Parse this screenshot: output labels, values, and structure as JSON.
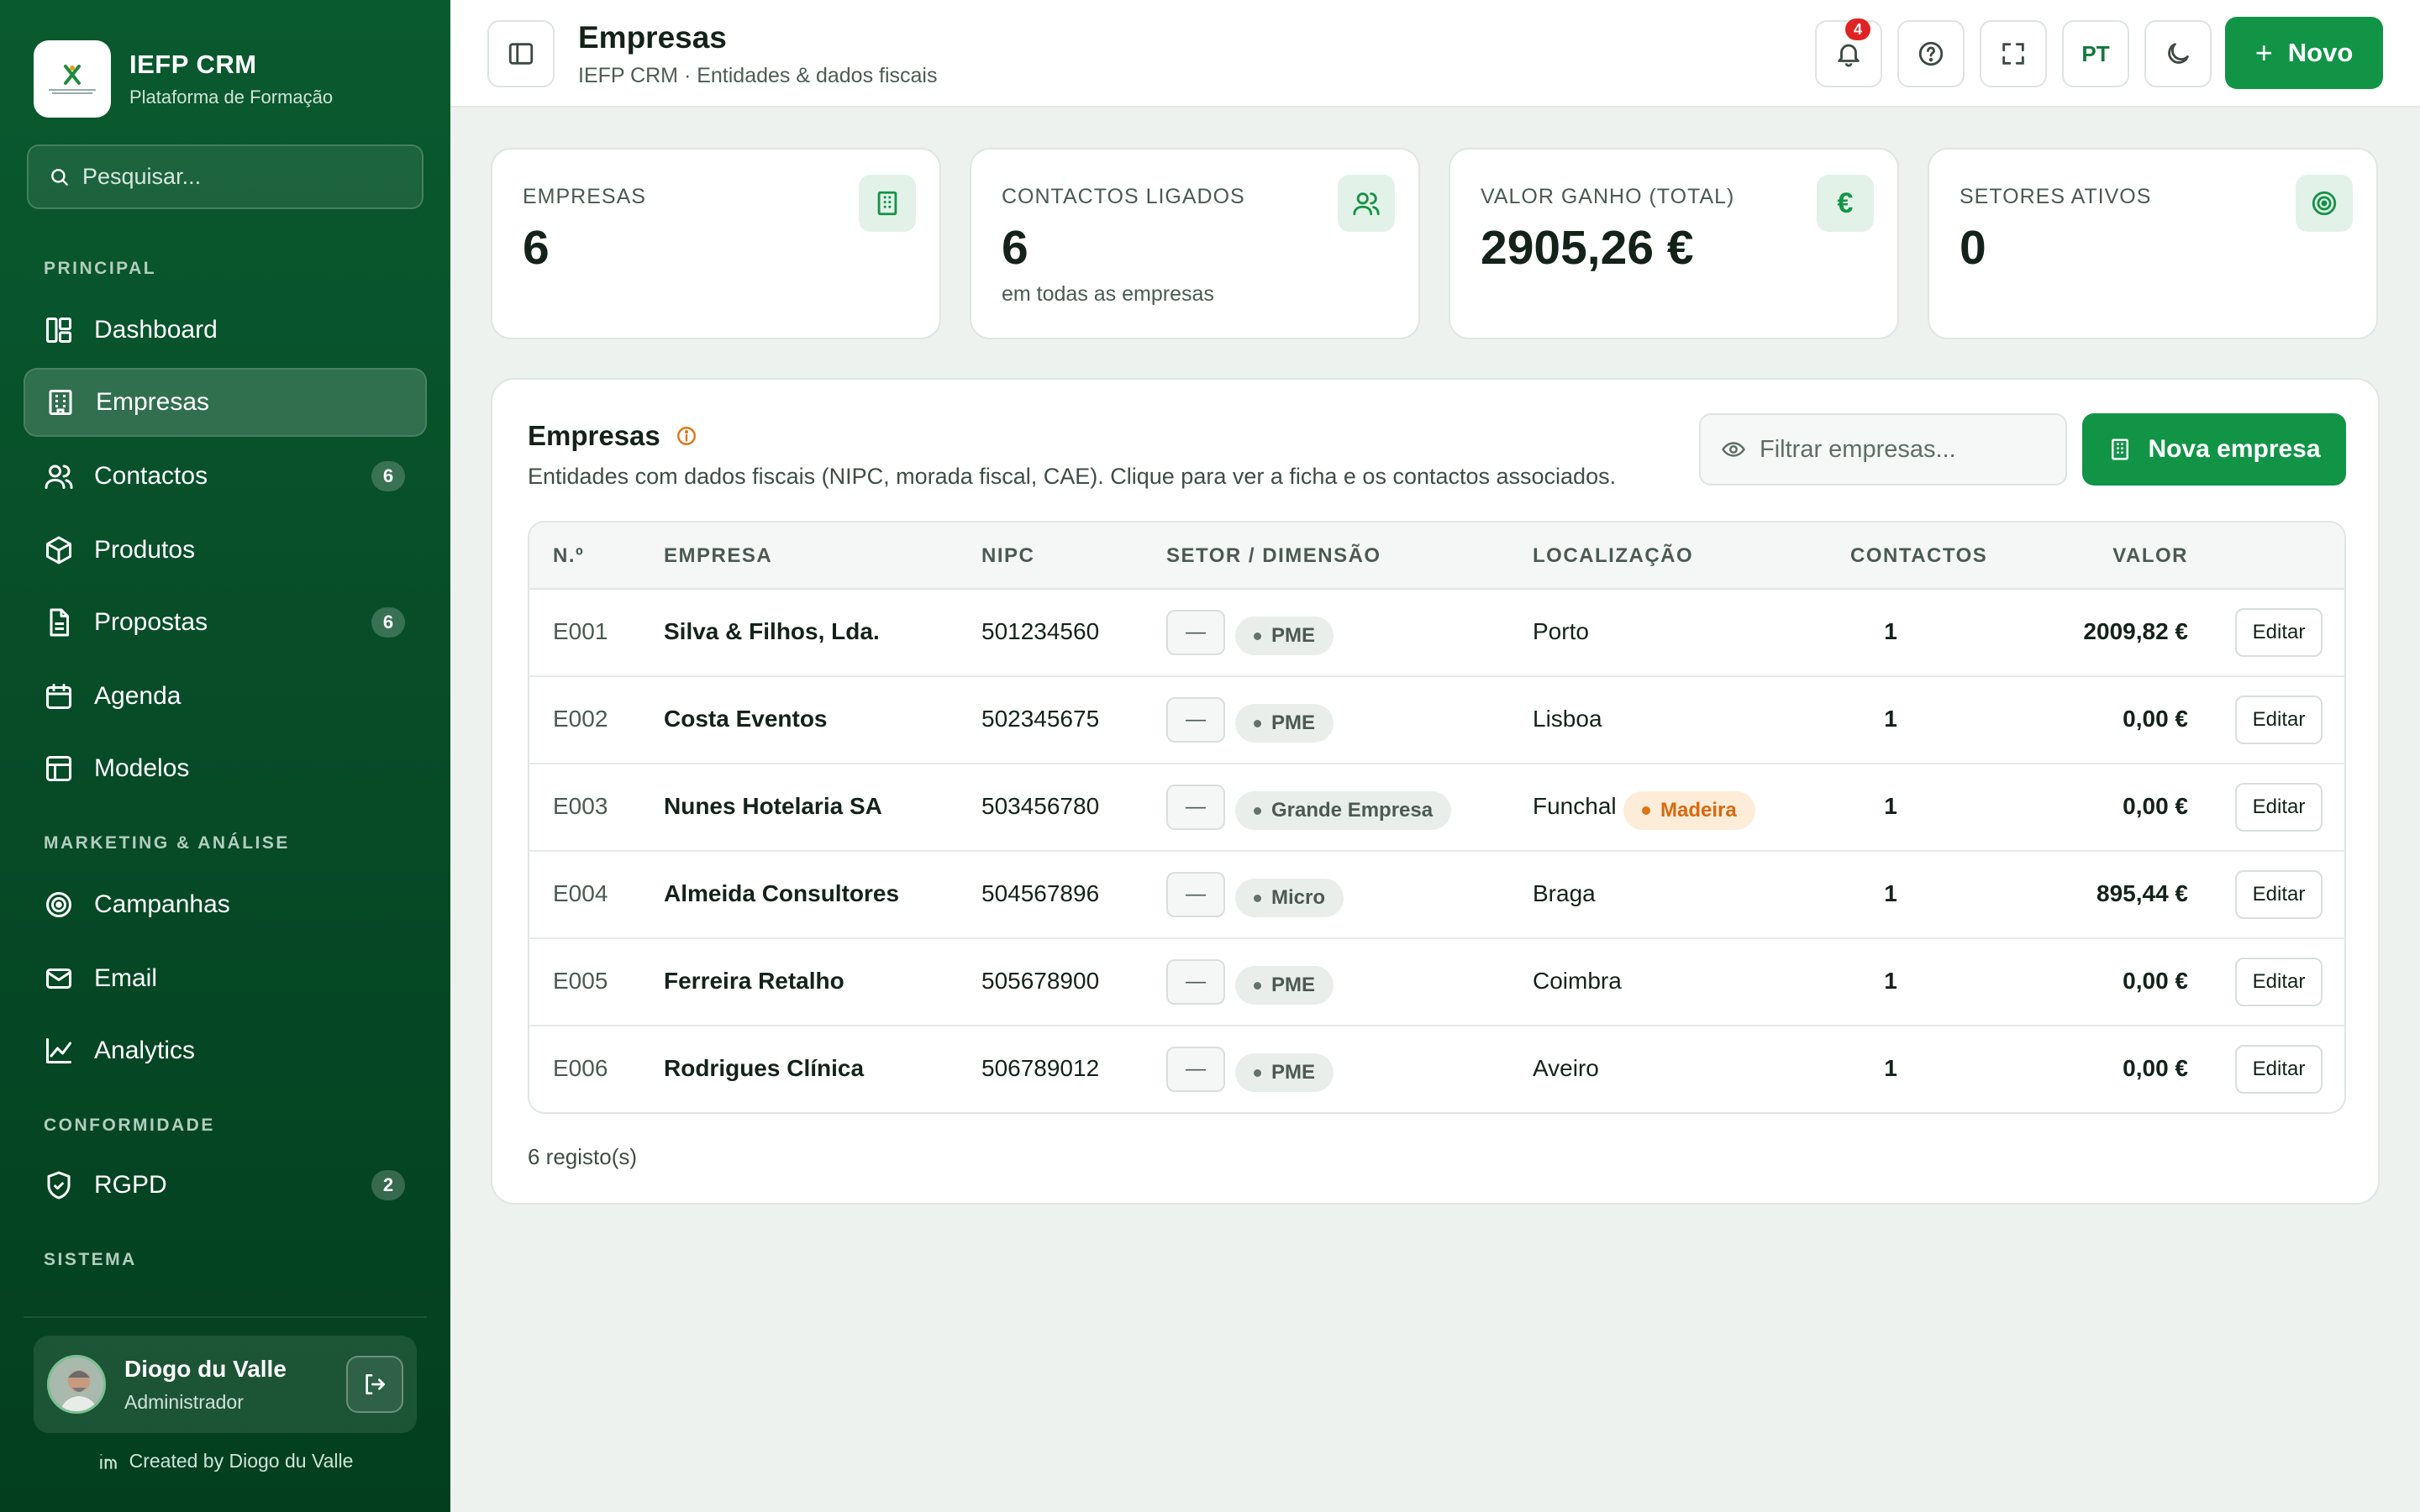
{
  "brand": {
    "name": "IEFP CRM",
    "subtitle": "Plataforma de Formação"
  },
  "search": {
    "placeholder": "Pesquisar..."
  },
  "sidebar": {
    "sections": {
      "principal": "PRINCIPAL",
      "marketing": "MARKETING & ANÁLISE",
      "conformidade": "CONFORMIDADE",
      "sistema": "SISTEMA"
    },
    "items": [
      {
        "label": "Dashboard",
        "icon": "dashboard-icon"
      },
      {
        "label": "Empresas",
        "icon": "building-icon",
        "active": true
      },
      {
        "label": "Contactos",
        "icon": "users-icon",
        "badge": "6"
      },
      {
        "label": "Produtos",
        "icon": "box-icon"
      },
      {
        "label": "Propostas",
        "icon": "file-icon",
        "badge": "6"
      },
      {
        "label": "Agenda",
        "icon": "calendar-icon"
      },
      {
        "label": "Modelos",
        "icon": "layout-icon"
      },
      {
        "label": "Campanhas",
        "icon": "target-icon"
      },
      {
        "label": "Email",
        "icon": "mail-icon"
      },
      {
        "label": "Analytics",
        "icon": "chart-icon"
      },
      {
        "label": "RGPD",
        "icon": "shield-icon",
        "badge": "2"
      }
    ]
  },
  "user": {
    "name": "Diogo du Valle",
    "role": "Administrador"
  },
  "credit": "Created by Diogo du Valle",
  "header": {
    "title": "Empresas",
    "subtitle": "IEFP CRM · Entidades & dados fiscais",
    "notifications": "4",
    "language": "PT",
    "new_label": "Novo"
  },
  "stats": [
    {
      "label": "EMPRESAS",
      "value": "6",
      "note": "",
      "icon": "building-icon"
    },
    {
      "label": "CONTACTOS LIGADOS",
      "value": "6",
      "note": "em todas as empresas",
      "icon": "users-icon"
    },
    {
      "label": "VALOR GANHO (TOTAL)",
      "value": "2905,26 €",
      "note": "",
      "icon": "euro-icon"
    },
    {
      "label": "SETORES ATIVOS",
      "value": "0",
      "note": "",
      "icon": "target-icon"
    }
  ],
  "companies": {
    "title": "Empresas",
    "description": "Entidades com dados fiscais (NIPC, morada fiscal, CAE). Clique para ver a ficha e os contactos associados.",
    "filter_placeholder": "Filtrar empresas...",
    "new_button": "Nova empresa",
    "columns": [
      "N.º",
      "EMPRESA",
      "NIPC",
      "SETOR / DIMENSÃO",
      "LOCALIZAÇÃO",
      "CONTACTOS",
      "VALOR"
    ],
    "rows": [
      {
        "id": "E001",
        "name": "Silva & Filhos, Lda.",
        "nipc": "501234560",
        "sector": "—",
        "size": "PME",
        "location": "Porto",
        "region": "",
        "contacts": "1",
        "value": "2009,82 €",
        "action": "Editar"
      },
      {
        "id": "E002",
        "name": "Costa Eventos",
        "nipc": "502345675",
        "sector": "—",
        "size": "PME",
        "location": "Lisboa",
        "region": "",
        "contacts": "1",
        "value": "0,00 €",
        "action": "Editar"
      },
      {
        "id": "E003",
        "name": "Nunes Hotelaria SA",
        "nipc": "503456780",
        "sector": "—",
        "size": "Grande Empresa",
        "location": "Funchal",
        "region": "Madeira",
        "contacts": "1",
        "value": "0,00 €",
        "action": "Editar"
      },
      {
        "id": "E004",
        "name": "Almeida Consultores",
        "nipc": "504567896",
        "sector": "—",
        "size": "Micro",
        "location": "Braga",
        "region": "",
        "contacts": "1",
        "value": "895,44 €",
        "action": "Editar"
      },
      {
        "id": "E005",
        "name": "Ferreira Retalho",
        "nipc": "505678900",
        "sector": "—",
        "size": "PME",
        "location": "Coimbra",
        "region": "",
        "contacts": "1",
        "value": "0,00 €",
        "action": "Editar"
      },
      {
        "id": "E006",
        "name": "Rodrigues Clínica",
        "nipc": "506789012",
        "sector": "—",
        "size": "PME",
        "location": "Aveiro",
        "region": "",
        "contacts": "1",
        "value": "0,00 €",
        "action": "Editar"
      }
    ],
    "count_label": "6 registo(s)"
  },
  "colors": {
    "primary": "#129447",
    "sidebar": "#064a26",
    "accent_orange": "#d9680e",
    "badge_red": "#e02424"
  }
}
